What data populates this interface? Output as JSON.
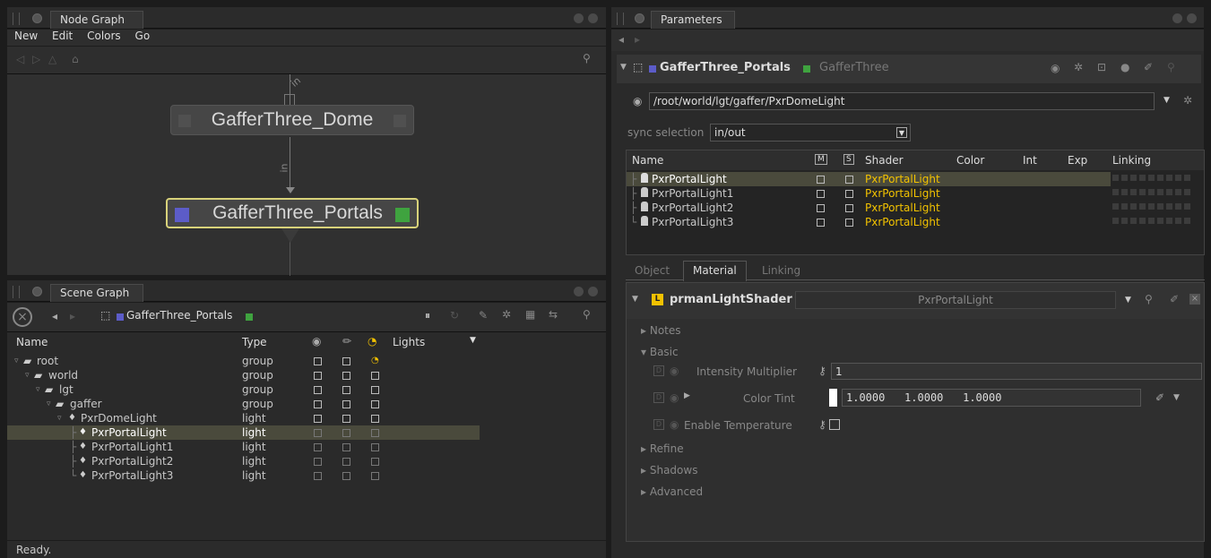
{
  "node_graph": {
    "tab_label": "Node Graph",
    "menu": [
      "New",
      "Edit",
      "Colors",
      "Go"
    ],
    "nodes": {
      "dome": "GafferThree_Dome",
      "portals": "GafferThree_Portals"
    },
    "edge_label_top": "in",
    "edge_label_mid": "in"
  },
  "scene_graph": {
    "tab_label": "Scene Graph",
    "breadcrumb": "GafferThree_Portals",
    "columns": {
      "name": "Name",
      "type": "Type",
      "lights": "Lights"
    },
    "rows": [
      {
        "name": "root",
        "type": "group"
      },
      {
        "name": "world",
        "type": "group"
      },
      {
        "name": "lgt",
        "type": "group"
      },
      {
        "name": "gaffer",
        "type": "group"
      },
      {
        "name": "PxrDomeLight",
        "type": "light"
      },
      {
        "name": "PxrPortalLight",
        "type": "light"
      },
      {
        "name": "PxrPortalLight1",
        "type": "light"
      },
      {
        "name": "PxrPortalLight2",
        "type": "light"
      },
      {
        "name": "PxrPortalLight3",
        "type": "light"
      }
    ],
    "status": "Ready."
  },
  "parameters": {
    "tab_label": "Parameters",
    "node_name": "GafferThree_Portals",
    "node_type": "GafferThree",
    "path": "/root/world/lgt/gaffer/PxrDomeLight",
    "sync_label": "sync selection",
    "sync_value": "in/out",
    "table_headers": {
      "name": "Name",
      "m": "M",
      "s": "S",
      "shader": "Shader",
      "color": "Color",
      "int": "Int",
      "exp": "Exp",
      "linking": "Linking"
    },
    "lights": [
      {
        "name": "PxrPortalLight",
        "shader": "PxrPortalLight"
      },
      {
        "name": "PxrPortalLight1",
        "shader": "PxrPortalLight"
      },
      {
        "name": "PxrPortalLight2",
        "shader": "PxrPortalLight"
      },
      {
        "name": "PxrPortalLight3",
        "shader": "PxrPortalLight"
      }
    ],
    "subtabs": [
      "Object",
      "Material",
      "Linking"
    ],
    "shader_badge": "L",
    "shader_group": "prmanLightShader",
    "shader_value": "PxrPortalLight",
    "sections": {
      "notes": "Notes",
      "basic": "Basic",
      "refine": "Refine",
      "shadows": "Shadows",
      "advanced": "Advanced"
    },
    "params": {
      "intensity_label": "Intensity Multiplier",
      "intensity_value": "1",
      "tint_label": "Color Tint",
      "tint_r": "1.0000",
      "tint_g": "1.0000",
      "tint_b": "1.0000",
      "temp_label": "Enable Temperature"
    }
  },
  "colors": {
    "node_blue": "#5c5cc8",
    "node_green": "#3fa33f",
    "selected_outline": "#d8d27a",
    "shader_yellow": "#f2c200"
  }
}
